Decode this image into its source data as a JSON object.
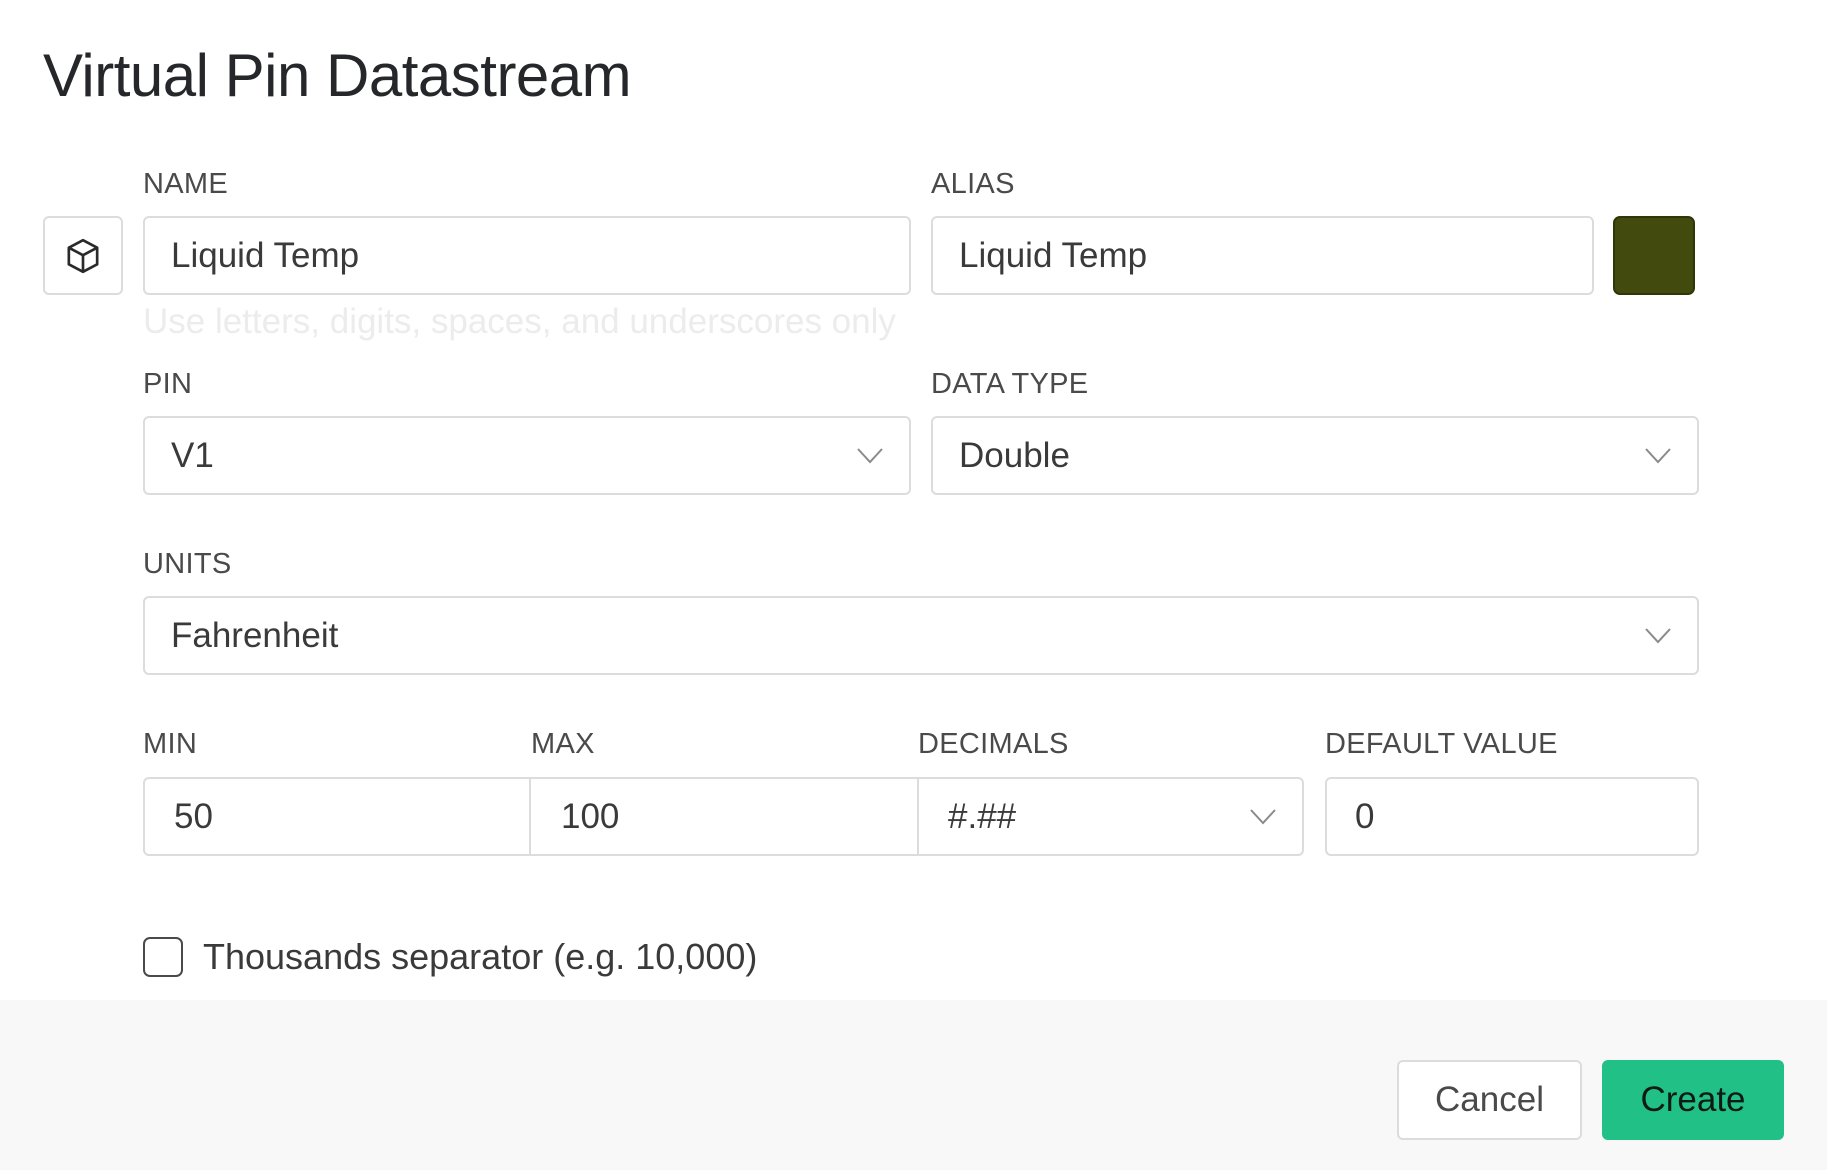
{
  "dialog": {
    "title": "Virtual Pin Datastream"
  },
  "colors": {
    "swatch": "#434a0e",
    "primary_button": "#21c087",
    "field_border": "#dcdcdc"
  },
  "form": {
    "name": {
      "label": "NAME",
      "value": "Liquid Temp",
      "hint": "Use letters, digits, spaces, and underscores only"
    },
    "alias": {
      "label": "ALIAS",
      "value": "Liquid Temp"
    },
    "datastream_icon": "cube-icon",
    "pin": {
      "label": "PIN",
      "value": "V1"
    },
    "data_type": {
      "label": "DATA TYPE",
      "value": "Double"
    },
    "units": {
      "label": "UNITS",
      "value": "Fahrenheit"
    },
    "min": {
      "label": "MIN",
      "value": "50"
    },
    "max": {
      "label": "MAX",
      "value": "100"
    },
    "decimals": {
      "label": "DECIMALS",
      "value": "#.##"
    },
    "default_value": {
      "label": "DEFAULT VALUE",
      "value": "0"
    },
    "thousands_separator": {
      "label": "Thousands separator (e.g. 10,000)",
      "checked": false
    }
  },
  "footer": {
    "cancel_label": "Cancel",
    "create_label": "Create"
  }
}
